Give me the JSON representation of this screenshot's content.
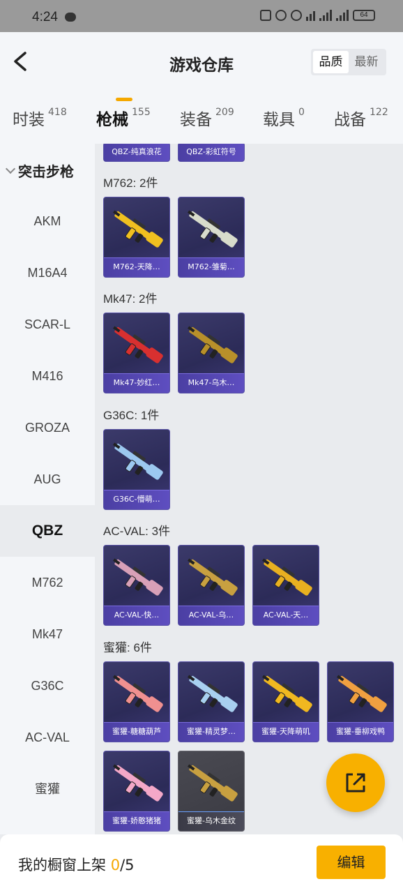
{
  "status_bar": {
    "time": "4:24",
    "battery": "64"
  },
  "header": {
    "title": "游戏仓库",
    "sort_options": [
      "品质",
      "最新"
    ],
    "sort_selected": "品质"
  },
  "tabs": [
    {
      "label": "时装",
      "count": "418"
    },
    {
      "label": "枪械",
      "count": "155"
    },
    {
      "label": "装备",
      "count": "209"
    },
    {
      "label": "载具",
      "count": "0"
    },
    {
      "label": "战备",
      "count": "122"
    }
  ],
  "sidebar": {
    "group": "突击步枪",
    "items": [
      "AKM",
      "M16A4",
      "SCAR-L",
      "M416",
      "GROZA",
      "AUG",
      "QBZ",
      "M762",
      "Mk47",
      "G36C",
      "AC-VAL",
      "蜜獾"
    ],
    "active": "QBZ"
  },
  "content": {
    "top_cards": [
      "QBZ-纯真浪花",
      "QBZ-彩虹符号"
    ],
    "sections": [
      {
        "title": "M762: 2件",
        "cards": [
          "M762-天降…",
          "M762-雏菊…"
        ],
        "colors": [
          "#f0c020",
          "#d8dccc"
        ]
      },
      {
        "title": "Mk47: 2件",
        "cards": [
          "Mk47-妙红…",
          "Mk47-乌木…"
        ],
        "colors": [
          "#d83030",
          "#b8902a"
        ]
      },
      {
        "title": "G36C: 1件",
        "cards": [
          "G36C-懵萌…"
        ],
        "colors": [
          "#9cc8f0"
        ]
      },
      {
        "title": "AC-VAL: 3件",
        "cards": [
          "AC-VAL-快…",
          "AC-VAL-乌…",
          "AC-VAL-天…"
        ],
        "colors": [
          "#d8a0b8",
          "#c8a040",
          "#e8b020"
        ]
      },
      {
        "title": "蜜獾: 6件",
        "cards": [
          "蜜獾-糖糖葫芦",
          "蜜獾-精灵梦…",
          "蜜獾-天降萌叽",
          "蜜獾-垂柳戏鸭",
          "蜜獾-娇憨猪猪",
          "蜜獾-乌木金纹"
        ],
        "colors": [
          "#f09090",
          "#a8d0f0",
          "#f0b820",
          "#f0a040",
          "#f4a8c8",
          "#c8a040"
        ]
      }
    ]
  },
  "bottom": {
    "label": "我的橱窗上架 ",
    "count": "0",
    "total": "/5",
    "edit": "编辑"
  }
}
